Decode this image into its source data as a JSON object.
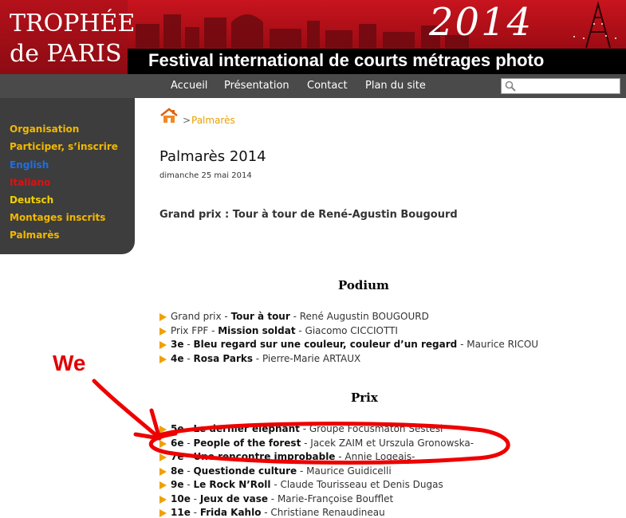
{
  "banner": {
    "logo_line1": "TROPHÉE",
    "logo_line2": "de PARIS",
    "year": "2014",
    "tagline": "Festival international de courts métrages photo"
  },
  "nav": {
    "items": [
      "Accueil",
      "Présentation",
      "Contact",
      "Plan du site"
    ],
    "search_value": ""
  },
  "sidebar": {
    "items": [
      {
        "label": "Organisation",
        "color": "#f2b800"
      },
      {
        "label": "Participer, s’inscrire",
        "color": "#f2b800"
      },
      {
        "label": "English",
        "color": "#1e6fe0"
      },
      {
        "label": "Italiano",
        "color": "#e01010"
      },
      {
        "label": "Deutsch",
        "color": "#f2d000"
      },
      {
        "label": "Montages inscrits",
        "color": "#f2b800"
      },
      {
        "label": "Palmarès",
        "color": "#f2b800"
      }
    ]
  },
  "breadcrumb": {
    "separator": ">",
    "current": "Palmarès"
  },
  "article": {
    "title": "Palmarès 2014",
    "date": "dimanche 25 mai 2014",
    "grand_prix": "Grand prix : Tour à tour de René-Agustin Bougourd"
  },
  "podium": {
    "heading": "Podium",
    "items": [
      {
        "prefix": "Grand prix",
        "title": "Tour à tour",
        "author": "René Augustin BOUGOURD",
        "prefix_bold": false
      },
      {
        "prefix": "Prix FPF",
        "title": "Mission soldat",
        "author": "Giacomo CICCIOTTI",
        "prefix_bold": false
      },
      {
        "prefix": "3e",
        "title": "Bleu regard sur une couleur, couleur d’un regard",
        "author": "Maurice RICOU",
        "prefix_bold": true
      },
      {
        "prefix": "4e",
        "title": "Rosa Parks",
        "author": "Pierre-Marie ARTAUX",
        "prefix_bold": true
      }
    ]
  },
  "prix": {
    "heading": "Prix",
    "items": [
      {
        "prefix": "5e",
        "title": "Le dernier éléphant",
        "author": "Groupe Focusmaton Sestesi"
      },
      {
        "prefix": "6e",
        "title": "People of the forest",
        "author": "Jacek ZAIM et Urszula Gronowska-"
      },
      {
        "prefix": "7e",
        "title": "Une rencontre improbable",
        "author": "Annie Logeais-"
      },
      {
        "prefix": "8e",
        "title": "Questionde culture",
        "author": "Maurice Guidicelli"
      },
      {
        "prefix": "9e",
        "title": "Le Rock N’Roll",
        "author": "Claude Tourisseau et Denis Dugas"
      },
      {
        "prefix": "10e",
        "title": "Jeux de vase",
        "author": "Marie-Françoise Boufflet"
      },
      {
        "prefix": "11e",
        "title": "Frida Kahlo",
        "author": "Christiane Renaudineau"
      }
    ]
  },
  "annotation": {
    "label": "We",
    "color": "#e00000"
  }
}
